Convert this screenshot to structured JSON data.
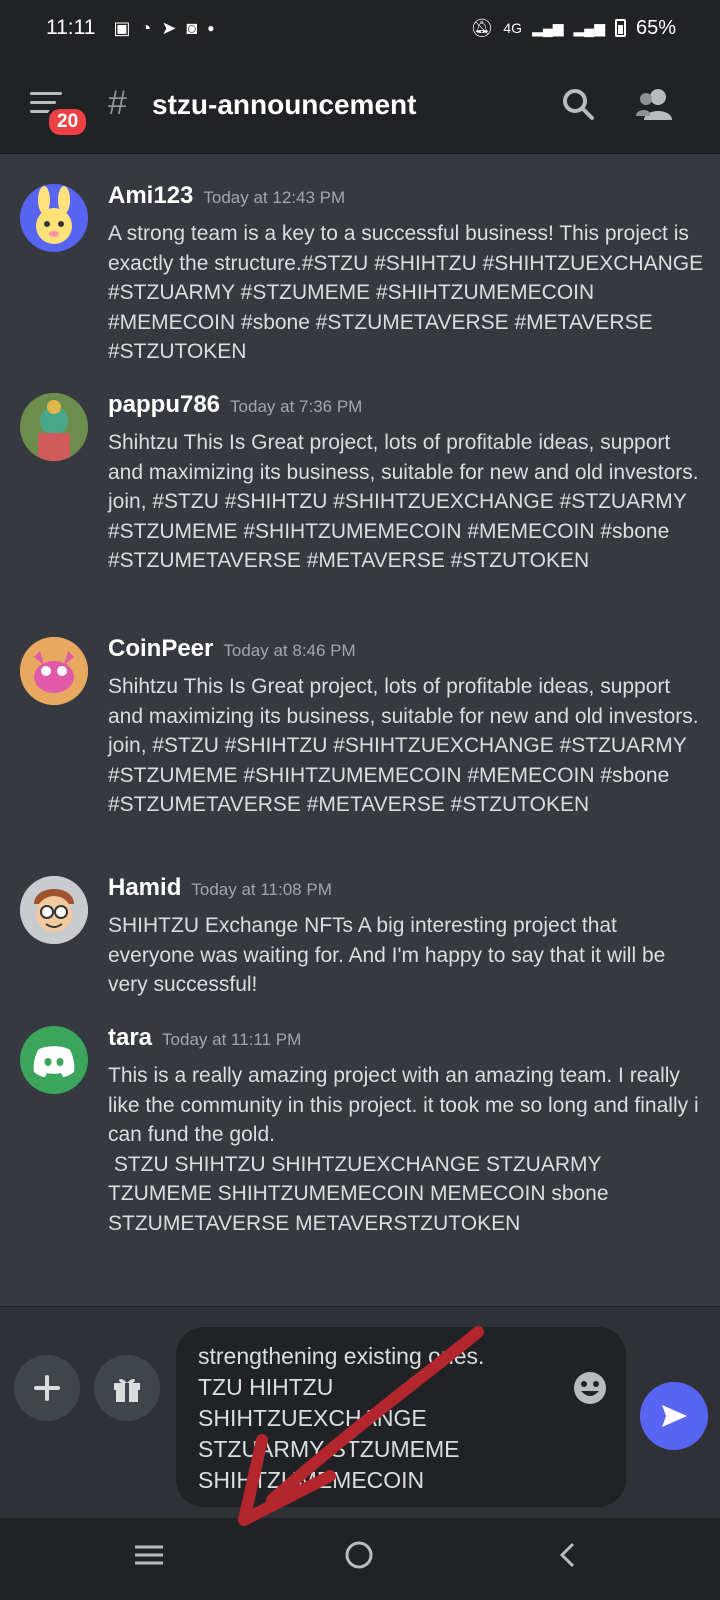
{
  "status_bar": {
    "time": "11:11",
    "notification_icons": [
      "gallery-icon",
      "messenger-icon",
      "telegram-icon",
      "app-icon",
      "dot-icon"
    ],
    "network": "4G",
    "battery": "65%"
  },
  "header": {
    "unread_count": "20",
    "hash_symbol": "#",
    "channel_name": "stzu-announcement"
  },
  "messages": [
    {
      "author": "Ami123",
      "timestamp": "Today at 12:43 PM",
      "avatar": "bunny-avatar",
      "text": "A strong team is a key to a successful business! This project is exactly the structure.#STZU #SHIHTZU #SHIHTZUEXCHANGE #STZUARMY #STZUMEME #SHIHTZUMEMECOIN #MEMECOIN #sbone #STZUMETAVERSE #METAVERSE #STZUTOKEN"
    },
    {
      "author": "pappu786",
      "timestamp": "Today at 7:36 PM",
      "avatar": "deity-avatar",
      "text": "Shihtzu This Is Great project, lots of profitable ideas, support and maximizing its business, suitable for new and old investors. join, #STZU #SHIHTZU #SHIHTZUEXCHANGE #STZUARMY #STZUMEME #SHIHTZUMEMECOIN #MEMECOIN #sbone #STZUMETAVERSE #METAVERSE #STZUTOKEN"
    },
    {
      "author": "CoinPeer",
      "timestamp": "Today at 8:46 PM",
      "avatar": "cartoon-avatar",
      "text": "Shihtzu This Is Great project, lots of profitable ideas, support and maximizing its business, suitable for new and old investors. join, #STZU #SHIHTZU #SHIHTZUEXCHANGE #STZUARMY #STZUMEME #SHIHTZUMEMECOIN #MEMECOIN #sbone #STZUMETAVERSE #METAVERSE #STZUTOKEN"
    },
    {
      "author": "Hamid",
      "timestamp": "Today at 11:08 PM",
      "avatar": "boy-glasses-avatar",
      "text": "SHIHTZU Exchange NFTs A big interesting project that everyone was waiting for. And I'm happy to say that it will be very successful!"
    },
    {
      "author": "tara",
      "timestamp": "Today at 11:11 PM",
      "avatar": "discord-logo-avatar",
      "text": "This is a really amazing project with an amazing team. I really like the community in this project. it took me so long and finally i can fund the gold.\n STZU SHIHTZU SHIHTZUEXCHANGE STZUARMY TZUMEME SHIHTZUMEMECOIN MEMECOIN sbone STZUMETAVERSE METAVERSTZUTOKEN"
    }
  ],
  "composer": {
    "draft_text": "strengthening existing ones.\nTZU HIHTZU\nSHIHTZUEXCHANGE\nSTZUARMY STZUMEME\nSHIHTZUMEMECOIN"
  },
  "colors": {
    "background": "#36393f",
    "header": "#202225",
    "accent": "#5865f2",
    "badge": "#ed4245",
    "annotation_arrow": "#b3262e"
  }
}
